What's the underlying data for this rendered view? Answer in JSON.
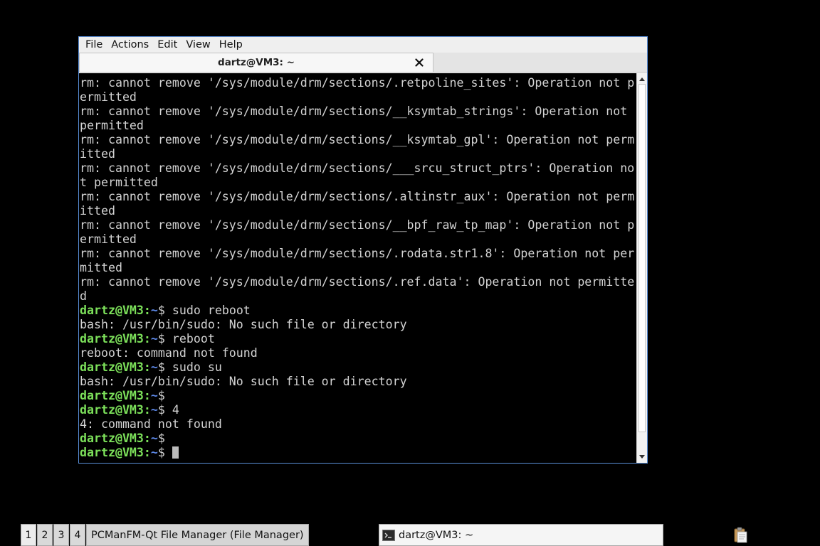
{
  "window": {
    "menu": [
      "File",
      "Actions",
      "Edit",
      "View",
      "Help"
    ],
    "tab_title": "dartz@VM3: ~"
  },
  "terminal": {
    "lines": [
      {
        "type": "out",
        "text": "rm: cannot remove '/sys/module/drm/sections/.retpoline_sites': Operation not p"
      },
      {
        "type": "out",
        "text": "ermitted"
      },
      {
        "type": "out",
        "text": "rm: cannot remove '/sys/module/drm/sections/__ksymtab_strings': Operation not "
      },
      {
        "type": "out",
        "text": "permitted"
      },
      {
        "type": "out",
        "text": "rm: cannot remove '/sys/module/drm/sections/__ksymtab_gpl': Operation not perm"
      },
      {
        "type": "out",
        "text": "itted"
      },
      {
        "type": "out",
        "text": "rm: cannot remove '/sys/module/drm/sections/___srcu_struct_ptrs': Operation no"
      },
      {
        "type": "out",
        "text": "t permitted"
      },
      {
        "type": "out",
        "text": "rm: cannot remove '/sys/module/drm/sections/.altinstr_aux': Operation not perm"
      },
      {
        "type": "out",
        "text": "itted"
      },
      {
        "type": "out",
        "text": "rm: cannot remove '/sys/module/drm/sections/__bpf_raw_tp_map': Operation not p"
      },
      {
        "type": "out",
        "text": "ermitted"
      },
      {
        "type": "out",
        "text": "rm: cannot remove '/sys/module/drm/sections/.rodata.str1.8': Operation not per"
      },
      {
        "type": "out",
        "text": "mitted"
      },
      {
        "type": "out",
        "text": "rm: cannot remove '/sys/module/drm/sections/.ref.data': Operation not permitte"
      },
      {
        "type": "out",
        "text": "d"
      },
      {
        "type": "prompt",
        "user": "dartz@VM3",
        "path": "~",
        "cmd": "sudo reboot"
      },
      {
        "type": "out",
        "text": "bash: /usr/bin/sudo: No such file or directory"
      },
      {
        "type": "prompt",
        "user": "dartz@VM3",
        "path": "~",
        "cmd": "reboot"
      },
      {
        "type": "out",
        "text": "reboot: command not found"
      },
      {
        "type": "prompt",
        "user": "dartz@VM3",
        "path": "~",
        "cmd": "sudo su"
      },
      {
        "type": "out",
        "text": "bash: /usr/bin/sudo: No such file or directory"
      },
      {
        "type": "prompt",
        "user": "dartz@VM3",
        "path": "~",
        "cmd": ""
      },
      {
        "type": "prompt",
        "user": "dartz@VM3",
        "path": "~",
        "cmd": "4"
      },
      {
        "type": "out",
        "text": "4: command not found"
      },
      {
        "type": "prompt",
        "user": "dartz@VM3",
        "path": "~",
        "cmd": ""
      },
      {
        "type": "prompt",
        "user": "dartz@VM3",
        "path": "~",
        "cmd": "",
        "cursor": true
      }
    ]
  },
  "taskbar": {
    "desktops": [
      "1",
      "2",
      "3",
      "4"
    ],
    "active_desktop": "1",
    "file_manager_label": "PCManFM-Qt File Manager (File Manager)",
    "terminal_label": "dartz@VM3: ~"
  },
  "colors": {
    "prompt_user": "#7ce05a",
    "prompt_path": "#5c87e6",
    "terminal_bg": "#000000",
    "terminal_fg": "#d3d3d3",
    "window_border": "#5a8fd8"
  },
  "icons": {
    "tab_close": "close-icon",
    "scroll_up": "arrow-up-icon",
    "scroll_down": "arrow-down-icon",
    "task_terminal": "terminal-icon",
    "tray_clipboard": "clipboard-icon"
  }
}
